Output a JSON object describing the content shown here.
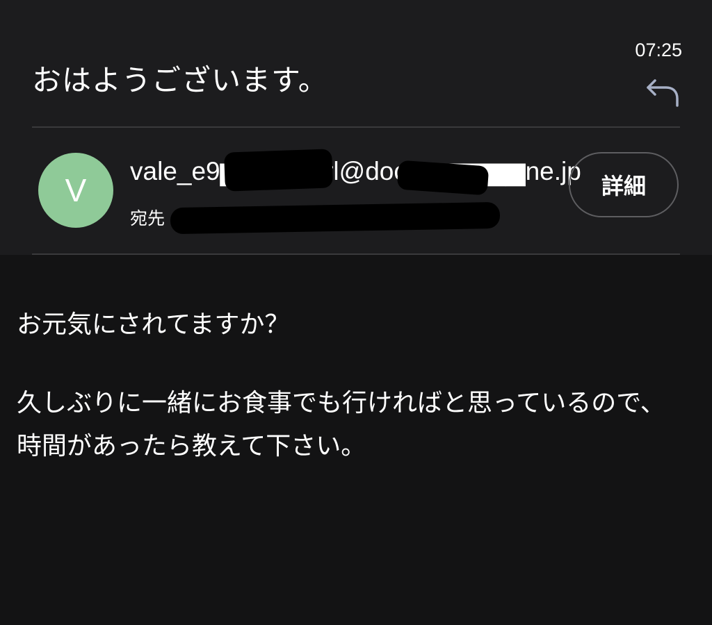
{
  "email": {
    "subject": "おはようございます。",
    "time": "07:25",
    "sender": {
      "avatar_letter": "V",
      "avatar_color": "#8fca98",
      "address": "vale_e9▆▆▆▆▆irl@doc▆▆▆▆▆▆ne.jp"
    },
    "recipient_label": "宛先",
    "detail_button": "詳細",
    "body": {
      "paragraph1": "お元気にされてますか？",
      "paragraph2": "久しぶりに一緒にお食事でも行ければと思っているので、時間があったら教えて下さい。"
    }
  },
  "icons": {
    "reply": "reply-arrow-icon"
  }
}
